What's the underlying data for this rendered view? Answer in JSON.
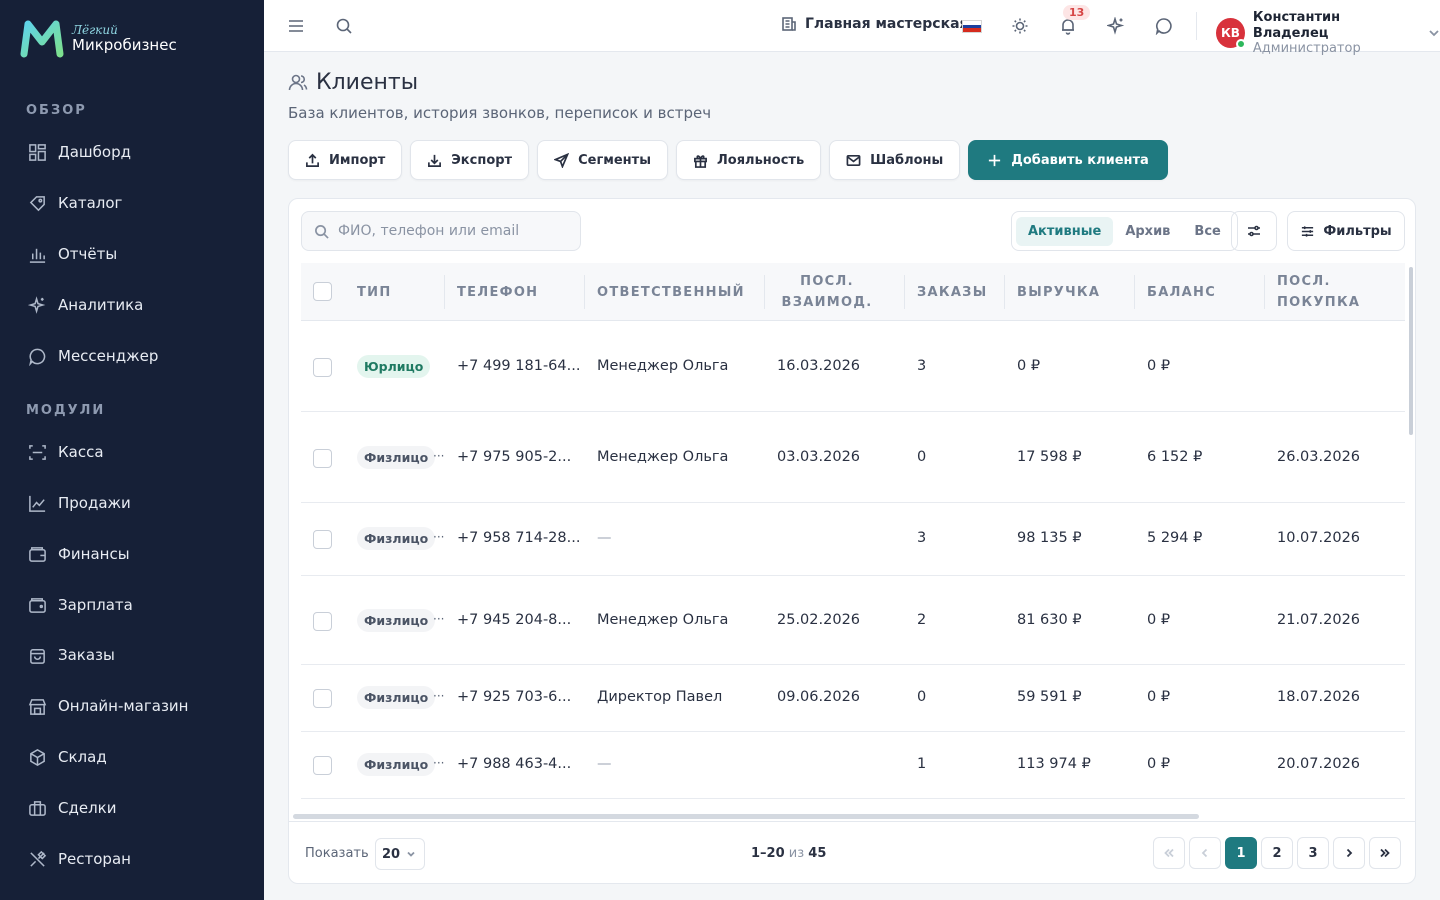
{
  "app": {
    "logo_small": "Лёгкий",
    "logo_big": "Микробизнес"
  },
  "sidebar": {
    "section_overview": "ОБЗОР",
    "section_modules": "МОДУЛИ",
    "items": [
      {
        "label": "Дашборд",
        "icon": "dashboard-icon"
      },
      {
        "label": "Каталог",
        "icon": "catalog-icon"
      },
      {
        "label": "Отчёты",
        "icon": "reports-icon"
      },
      {
        "label": "Аналитика",
        "icon": "analytics-icon"
      },
      {
        "label": "Мессенджер",
        "icon": "messenger-icon"
      },
      {
        "label": "Касса",
        "icon": "cashbox-icon"
      },
      {
        "label": "Продажи",
        "icon": "sales-icon"
      },
      {
        "label": "Финансы",
        "icon": "finance-icon"
      },
      {
        "label": "Зарплата",
        "icon": "salary-icon"
      },
      {
        "label": "Заказы",
        "icon": "orders-icon"
      },
      {
        "label": "Онлайн-магазин",
        "icon": "store-icon"
      },
      {
        "label": "Склад",
        "icon": "warehouse-icon"
      },
      {
        "label": "Сделки",
        "icon": "deals-icon"
      },
      {
        "label": "Ресторан",
        "icon": "restaurant-icon"
      }
    ]
  },
  "topbar": {
    "workshop": "Главная мастерская",
    "notifications_count": "13",
    "user_initials": "КВ",
    "user_name": "Константин Владелец",
    "user_role": "Администратор",
    "flag_colors": [
      "#ffffff",
      "#1c3f9e",
      "#d52b1e"
    ]
  },
  "page": {
    "title": "Клиенты",
    "subtitle": "База клиентов, история звонков, переписок и встреч"
  },
  "actions": {
    "import": "Импорт",
    "export": "Экспорт",
    "segments": "Сегменты",
    "loyalty": "Лояльность",
    "templates": "Шаблоны",
    "add_client": "Добавить клиента"
  },
  "toolbar": {
    "search_placeholder": "ФИО, телефон или email",
    "tab_active": "Активные",
    "tab_archive": "Архив",
    "tab_all": "Все",
    "filters": "Фильтры"
  },
  "table": {
    "columns": {
      "type": "ТИП",
      "phone": "ТЕЛЕФОН",
      "responsible": "ОТВЕТСТВЕННЫЙ",
      "last_interaction_1": "ПОСЛ.",
      "last_interaction_2": "ВЗАИМОД.",
      "orders": "ЗАКАЗЫ",
      "revenue": "ВЫРУЧКА",
      "balance": "БАЛАНС",
      "last_purchase_1": "ПОСЛ.",
      "last_purchase_2": "ПОКУПКА"
    },
    "rows": [
      {
        "type": "Юрлицо",
        "phone": "+7 499 181-64...",
        "responsible": "Менеджер Ольга",
        "last_interaction": "16.03.2026",
        "orders": "3",
        "revenue": "0 ₽",
        "balance": "0 ₽",
        "last_purchase": ""
      },
      {
        "type": "Физлицо",
        "phone": "+7 975 905-2...",
        "responsible": "Менеджер Ольга",
        "last_interaction": "03.03.2026",
        "orders": "0",
        "revenue": "17 598 ₽",
        "balance": "6 152 ₽",
        "last_purchase": "26.03.2026"
      },
      {
        "type": "Физлицо",
        "phone": "+7 958 714-28...",
        "responsible": "—",
        "last_interaction": "",
        "orders": "3",
        "revenue": "98 135 ₽",
        "balance": "5 294 ₽",
        "last_purchase": "10.07.2026"
      },
      {
        "type": "Физлицо",
        "phone": "+7 945 204-8...",
        "responsible": "Менеджер Ольга",
        "last_interaction": "25.02.2026",
        "orders": "2",
        "revenue": "81 630 ₽",
        "balance": "0 ₽",
        "last_purchase": "21.07.2026"
      },
      {
        "type": "Физлицо",
        "phone": "+7 925 703-6...",
        "responsible": "Директор Павел",
        "last_interaction": "09.06.2026",
        "orders": "0",
        "revenue": "59 591 ₽",
        "balance": "0 ₽",
        "last_purchase": "18.07.2026"
      },
      {
        "type": "Физлицо",
        "phone": "+7 988 463-4...",
        "responsible": "—",
        "last_interaction": "",
        "orders": "1",
        "revenue": "113 974 ₽",
        "balance": "0 ₽",
        "last_purchase": "20.07.2026"
      }
    ],
    "more_indicator": "···"
  },
  "footer": {
    "show_label": "Показать",
    "page_size": "20",
    "range": "1–20",
    "of": "из",
    "total": "45",
    "pages": [
      "1",
      "2",
      "3"
    ],
    "current_page": "1"
  },
  "colors": {
    "sidebar_bg": "#162037",
    "accent": "#1f7a80",
    "legal_tag": "#1f7a62"
  }
}
